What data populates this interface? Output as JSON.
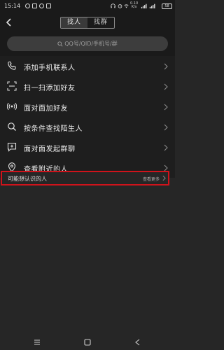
{
  "status_bar": {
    "time": "15:14",
    "speed_top": "0.10",
    "speed_bottom": "K/s",
    "battery": "58",
    "icons": [
      "app-badge-icon",
      "media-icon",
      "settings-icon",
      "nfc-icon",
      "headphones-icon",
      "alarm-icon",
      "wifi-icon",
      "signal-icon",
      "battery-icon"
    ]
  },
  "header": {
    "tabs": [
      {
        "label": "找人",
        "active": true
      },
      {
        "label": "找群",
        "active": false
      }
    ]
  },
  "search": {
    "placeholder": "QQ号/QID/手机号/群"
  },
  "menu": {
    "items": [
      {
        "icon": "phone-icon",
        "label": "添加手机联系人"
      },
      {
        "icon": "scan-icon",
        "label": "扫一扫添加好友"
      },
      {
        "icon": "face-to-face-icon",
        "label": "面对面加好友"
      },
      {
        "icon": "search-icon",
        "label": "按条件查找陌生人"
      },
      {
        "icon": "group-chat-icon",
        "label": "面对面发起群聊"
      },
      {
        "icon": "location-icon",
        "label": "查看附近的人"
      }
    ]
  },
  "suggestions": {
    "title": "可能想认识的人",
    "more": "查看更多"
  },
  "colors": {
    "background": "#262626",
    "panel": "#1e1e1e",
    "highlight_border": "#d0131b"
  }
}
